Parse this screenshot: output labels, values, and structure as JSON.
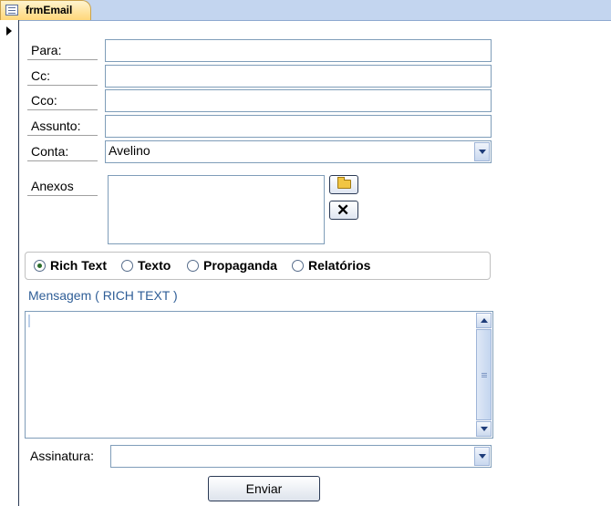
{
  "tab": {
    "title": "frmEmail",
    "icon": "form-icon"
  },
  "fields": {
    "para_label": "Para:",
    "cc_label": "Cc:",
    "cco_label": "Cco:",
    "assunto_label": "Assunto:",
    "conta_label": "Conta:",
    "conta_value": "Avelino"
  },
  "attachments": {
    "label": "Anexos",
    "add_icon": "folder-open-icon",
    "remove_icon": "close-icon"
  },
  "format_options": [
    {
      "label": "Rich Text",
      "selected": true
    },
    {
      "label": "Texto",
      "selected": false
    },
    {
      "label": "Propaganda",
      "selected": false
    },
    {
      "label": "Relatórios",
      "selected": false
    }
  ],
  "message": {
    "label": "Mensagem ( RICH TEXT )"
  },
  "signature": {
    "label": "Assinatura:",
    "value": ""
  },
  "actions": {
    "send_label": "Enviar"
  },
  "colors": {
    "tab_active": "#ffd77a",
    "tabbar": "#c3d5ef",
    "label_blue": "#2f5e97",
    "border": "#7f9db9"
  }
}
